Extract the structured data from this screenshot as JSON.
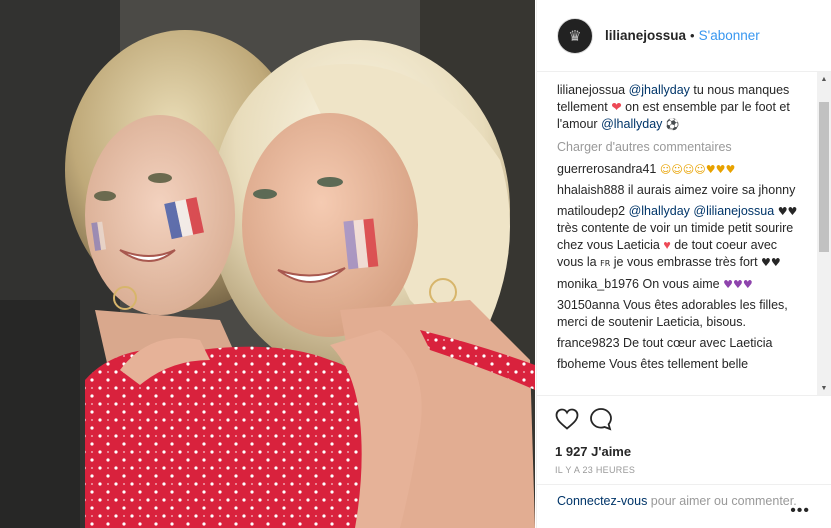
{
  "post": {
    "username": "lilianejossua",
    "separator": "•",
    "follow_label": "S'abonner",
    "caption": {
      "user": "lilianejossua",
      "mention1": "@jhallyday",
      "text1": " tu nous manques tellement ",
      "heart": "❤",
      "text2": " on est ensemble par le foot et l'amour ",
      "mention2": "@lhallyday",
      "ball": "⚽"
    },
    "load_more": "Charger d'autres commentaires",
    "comments": [
      {
        "user": "guerrerosandra41",
        "text": "",
        "emoji": "☺☺☺☺♥♥♥"
      },
      {
        "user": "hhalaish888",
        "text": "il aurais aimez voire sa jhonny"
      },
      {
        "user": "matiloudep2",
        "mention1": "@lhallyday",
        "mention2": "@lilianejossua",
        "text_a": " très contente de voir un timide petit sourire chez vous Laeticia ",
        "text_b": " de tout coeur avec vous la ",
        "flag": "FR",
        "text_c": " je vous embrasse très fort ",
        "lead_hearts": "♥♥",
        "heart_red": "♥",
        "end_hearts": "♥♥"
      },
      {
        "user": "monika_b1976",
        "text": "On vous aime ",
        "emoji": "♥♥♥"
      },
      {
        "user": "30150anna",
        "text": "Vous êtes adorables les filles, merci de soutenir Laeticia, bisous."
      },
      {
        "user": "france9823",
        "text": "De tout cœur avec Laeticia"
      },
      {
        "user": "fboheme",
        "text": "Vous êtes tellement belle"
      }
    ],
    "likes": "1 927 J'aime",
    "timestamp": "IL Y A 23 HEURES",
    "login_link": "Connectez-vous",
    "login_text": " pour aimer ou commenter.",
    "more_label": "•••"
  },
  "colors": {
    "link": "#003569",
    "follow": "#3897f0",
    "heart": "#ed4956",
    "muted": "#999999"
  },
  "icons": {
    "like": "heart-outline-icon",
    "comment": "speech-bubble-icon",
    "more": "more-dots-icon"
  }
}
